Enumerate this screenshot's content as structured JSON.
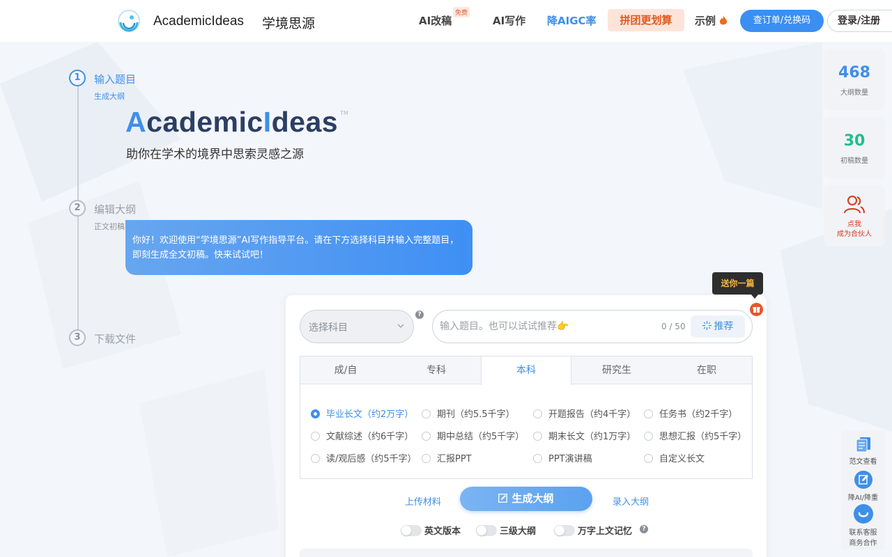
{
  "header": {
    "brand_en": "AcademicIdeas",
    "brand_cn": "学境思源",
    "nav": {
      "ai_rewrite": "AI改稿",
      "ai_rewrite_badge": "免费",
      "ai_write": "AI写作",
      "reduce_aigc": "降AIGC率",
      "group_buy": "拼团更划算",
      "examples": "示例"
    },
    "order_button": "查订单/兑换码",
    "login_button": "登录/注册"
  },
  "steps": [
    {
      "num": "1",
      "title": "输入题目",
      "sub": "生成大纲"
    },
    {
      "num": "2",
      "title": "编辑大纲",
      "sub": "正文初稿"
    },
    {
      "num": "3",
      "title": "下载文件",
      "sub": ""
    }
  ],
  "hero": {
    "logo_a": "A",
    "logo_mid": "cademic",
    "logo_i": "I",
    "logo_end": "deas",
    "tm": "TM",
    "tagline": "助你在学术的境界中思索灵感之源"
  },
  "bubble": {
    "text": "你好！欢迎使用“学境思源”AI写作指导平台。请在下方选择科目并输入完整题目，即刻生成全文初稿。快来试试吧！"
  },
  "form": {
    "subject_placeholder": "选择科目",
    "topic_placeholder": "输入题目。也可以试试推荐👉",
    "topic_count": "0 / 50",
    "recommend_button": "推荐",
    "gift_tip": "送你一篇",
    "tabs": [
      "成/自",
      "专科",
      "本科",
      "研究生",
      "在职"
    ],
    "active_tab": 2,
    "options": [
      "毕业长文（约2万字）",
      "期刊（约5.5千字）",
      "开题报告（约4千字）",
      "任务书（约2千字）",
      "文献综述（约6千字）",
      "期中总结（约5千字）",
      "期末长文（约1万字）",
      "思想汇报（约5千字）",
      "读/观后感（约5千字）",
      "汇报PPT",
      "PPT演讲稿",
      "自定义长文"
    ],
    "selected_option": 0,
    "upload_link": "上传材料",
    "generate_button": "生成大纲",
    "import_link": "录入大纲",
    "toggles": [
      "英文版本",
      "三级大纲",
      "万字上文记忆"
    ]
  },
  "widgets": {
    "outline_count": "468",
    "outline_label": "大纲数量",
    "draft_count": "30",
    "draft_label": "初稿数量",
    "partner_line1": "点我",
    "partner_line2": "成为合伙人"
  },
  "tools": {
    "sample": "范文查看",
    "reduce": "降AI/降重",
    "service_line1": "联系客服",
    "service_line2": "商务合作"
  },
  "colors": {
    "accent": "#3f8fe8",
    "orange": "#e25a1d",
    "teal": "#1fbf8f",
    "partner_red": "#d9361c"
  }
}
